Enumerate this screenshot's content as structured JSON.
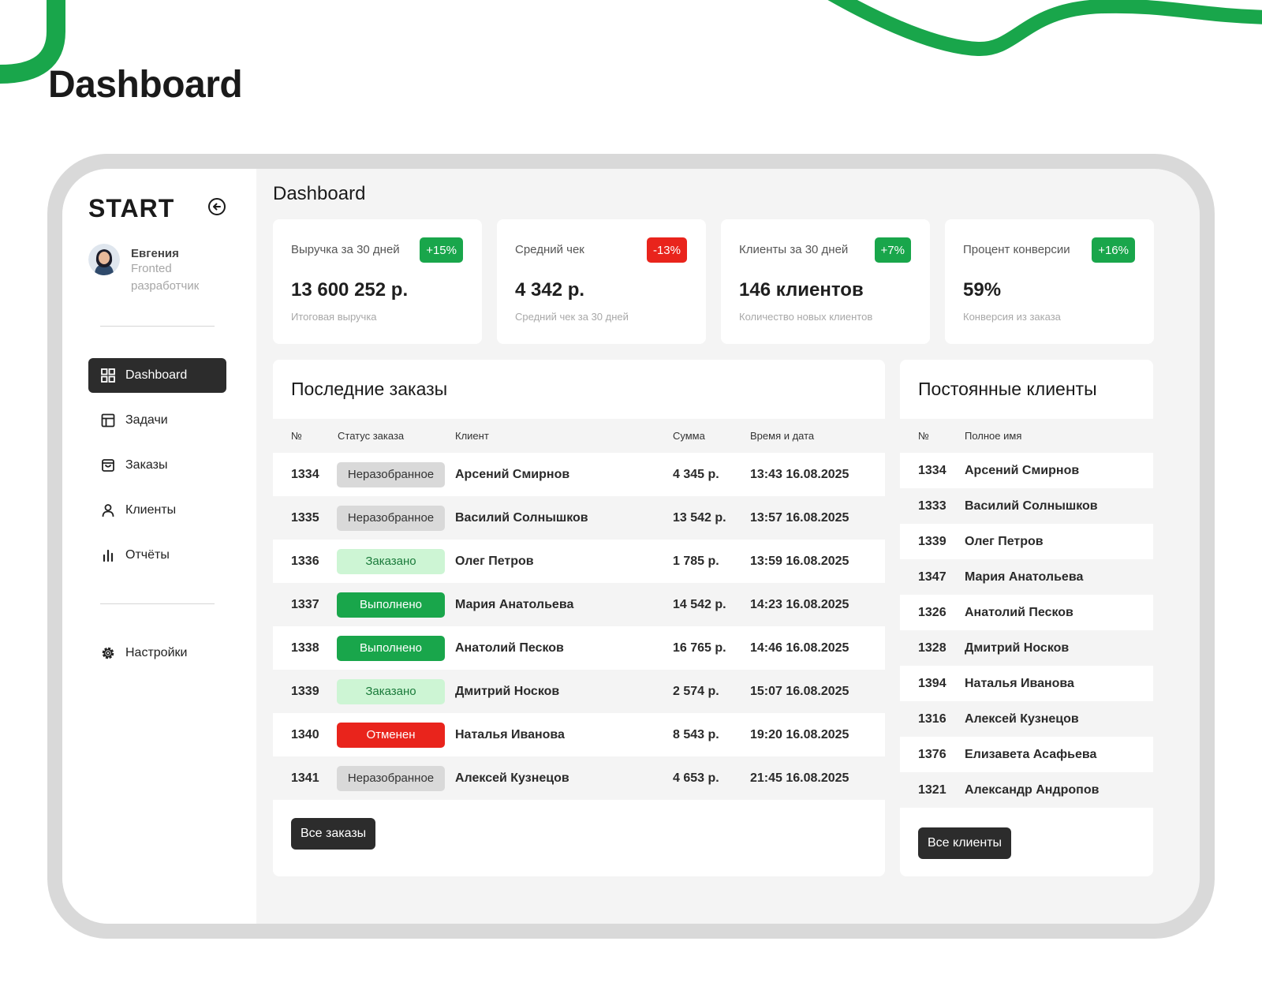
{
  "page": {
    "title": "Dashboard"
  },
  "colors": {
    "accent_green": "#19a64b",
    "danger_red": "#e9241c",
    "light_green": "#cdf5d4",
    "neutral_gray": "#d9d9d9",
    "dark": "#2c2c2c"
  },
  "sidebar": {
    "brand": "START",
    "collapse_icon": "arrow-left-circle-icon",
    "user": {
      "name": "Евгения",
      "role": "Fronted разработчик"
    },
    "items": [
      {
        "label": "Dashboard",
        "icon": "grid-icon",
        "active": true
      },
      {
        "label": "Задачи",
        "icon": "layout-icon",
        "active": false
      },
      {
        "label": "Заказы",
        "icon": "bag-icon",
        "active": false
      },
      {
        "label": "Клиенты",
        "icon": "user-icon",
        "active": false
      },
      {
        "label": "Отчёты",
        "icon": "bar-chart-icon",
        "active": false
      }
    ],
    "settings": {
      "label": "Настройки",
      "icon": "gear-icon"
    }
  },
  "main": {
    "title": "Dashboard",
    "stats": [
      {
        "label": "Выручка за 30 дней",
        "badge": "+15%",
        "badge_type": "up",
        "value": "13 600 252 р.",
        "note": "Итоговая выручка"
      },
      {
        "label": "Средний чек",
        "badge": "-13%",
        "badge_type": "down",
        "value": "4 342 р.",
        "note": "Средний чек за 30 дней"
      },
      {
        "label": "Клиенты за 30 дней",
        "badge": "+7%",
        "badge_type": "up",
        "value": "146 клиентов",
        "note": "Количество новых клиентов"
      },
      {
        "label": "Процент конверсии",
        "badge": "+16%",
        "badge_type": "up",
        "value": "59%",
        "note": "Конверсия из заказа"
      }
    ],
    "orders": {
      "title": "Последние заказы",
      "headers": [
        "№",
        "Статус заказа",
        "Клиент",
        "Сумма",
        "Время и дата"
      ],
      "rows": [
        {
          "id": "1334",
          "status": "Неразобранное",
          "status_type": "new",
          "client": "Арсений Смирнов",
          "sum": "4 345 р.",
          "datetime": "13:43 16.08.2025"
        },
        {
          "id": "1335",
          "status": "Неразобранное",
          "status_type": "new",
          "client": "Василий Солнышков",
          "sum": "13 542 р.",
          "datetime": "13:57 16.08.2025"
        },
        {
          "id": "1336",
          "status": "Заказано",
          "status_type": "ordered",
          "client": "Олег Петров",
          "sum": "1 785 р.",
          "datetime": "13:59 16.08.2025"
        },
        {
          "id": "1337",
          "status": "Выполнено",
          "status_type": "done",
          "client": "Мария Анатольева",
          "sum": "14 542 р.",
          "datetime": "14:23 16.08.2025"
        },
        {
          "id": "1338",
          "status": "Выполнено",
          "status_type": "done",
          "client": "Анатолий Песков",
          "sum": "16 765 р.",
          "datetime": "14:46 16.08.2025"
        },
        {
          "id": "1339",
          "status": "Заказано",
          "status_type": "ordered",
          "client": "Дмитрий Носков",
          "sum": "2 574 р.",
          "datetime": "15:07 16.08.2025"
        },
        {
          "id": "1340",
          "status": "Отменен",
          "status_type": "cancelled",
          "client": "Наталья Иванова",
          "sum": "8 543 р.",
          "datetime": "19:20 16.08.2025"
        },
        {
          "id": "1341",
          "status": "Неразобранное",
          "status_type": "new",
          "client": "Алексей Кузнецов",
          "sum": "4 653 р.",
          "datetime": "21:45 16.08.2025"
        }
      ],
      "button": "Все заказы"
    },
    "clients": {
      "title": "Постоянные клиенты",
      "headers": [
        "№",
        "Полное имя"
      ],
      "rows": [
        {
          "id": "1334",
          "name": "Арсений Смирнов"
        },
        {
          "id": "1333",
          "name": "Василий Солнышков"
        },
        {
          "id": "1339",
          "name": "Олег Петров"
        },
        {
          "id": "1347",
          "name": "Мария Анатольева"
        },
        {
          "id": "1326",
          "name": "Анатолий Песков"
        },
        {
          "id": "1328",
          "name": "Дмитрий Носков"
        },
        {
          "id": "1394",
          "name": "Наталья Иванова"
        },
        {
          "id": "1316",
          "name": "Алексей Кузнецов"
        },
        {
          "id": "1376",
          "name": "Елизавета Асафьева"
        },
        {
          "id": "1321",
          "name": "Александр Андропов"
        }
      ],
      "button": "Все клиенты"
    }
  }
}
